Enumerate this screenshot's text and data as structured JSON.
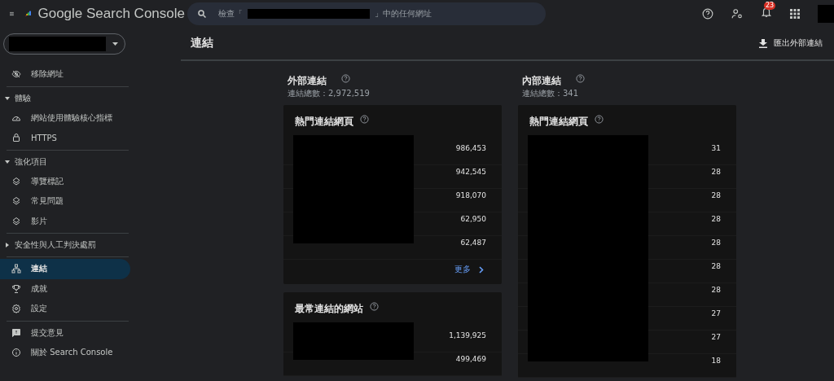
{
  "app": {
    "title": "Google Search Console",
    "notifications": "23"
  },
  "search": {
    "prefix": "檢查「",
    "suffix": "」中的任何網址"
  },
  "page": {
    "title": "連結",
    "export": "匯出外部連結"
  },
  "sidebar": {
    "groups": [
      {
        "items": [
          {
            "label": "移除網址",
            "selected": false
          }
        ]
      },
      {
        "section": {
          "label": "體驗",
          "expanded": true
        },
        "items": [
          {
            "label": "網站使用體驗核心指標",
            "selected": false
          },
          {
            "label": "HTTPS",
            "selected": false
          }
        ]
      },
      {
        "section": {
          "label": "強化項目",
          "expanded": true
        },
        "items": [
          {
            "label": "導覽標記",
            "selected": false
          },
          {
            "label": "常見問題",
            "selected": false
          },
          {
            "label": "影片",
            "selected": false
          }
        ]
      },
      {
        "section": {
          "label": "安全性與人工判決處罰",
          "expanded": false
        }
      },
      {
        "items": [
          {
            "label": "連結",
            "selected": true
          },
          {
            "label": "成就",
            "selected": false
          },
          {
            "label": "設定",
            "selected": false
          }
        ]
      },
      {
        "items": [
          {
            "label": "提交意見",
            "selected": false
          },
          {
            "label": "關於 Search Console",
            "selected": false
          }
        ]
      }
    ]
  },
  "columns": [
    {
      "title": "外部連結",
      "total": "連結總數：2,972,519",
      "cards": [
        {
          "title": "熱門連結網頁",
          "values": [
            "986,453",
            "942,545",
            "918,070",
            "62,950",
            "62,487"
          ],
          "more": "更多"
        },
        {
          "title": "最常連結的網站",
          "values": [
            "1,139,925",
            "499,469"
          ]
        }
      ]
    },
    {
      "title": "內部連結",
      "total": "連結總數：341",
      "cards": [
        {
          "title": "熱門連結網頁",
          "values": [
            "31",
            "28",
            "28",
            "28",
            "28",
            "28",
            "28",
            "27",
            "27",
            "18"
          ]
        }
      ]
    }
  ]
}
